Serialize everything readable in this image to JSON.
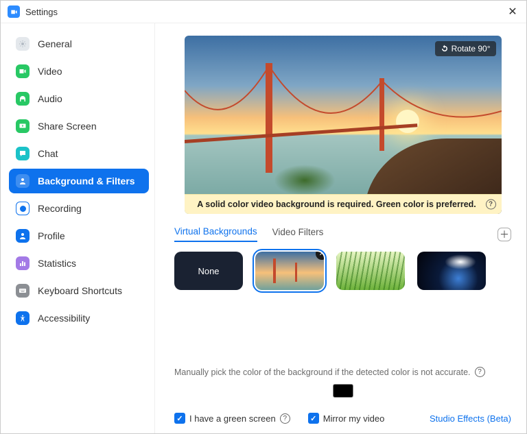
{
  "window": {
    "title": "Settings"
  },
  "sidebar": {
    "items": [
      {
        "label": "General"
      },
      {
        "label": "Video"
      },
      {
        "label": "Audio"
      },
      {
        "label": "Share Screen"
      },
      {
        "label": "Chat"
      },
      {
        "label": "Background & Filters"
      },
      {
        "label": "Recording"
      },
      {
        "label": "Profile"
      },
      {
        "label": "Statistics"
      },
      {
        "label": "Keyboard Shortcuts"
      },
      {
        "label": "Accessibility"
      }
    ],
    "active_index": 5
  },
  "preview": {
    "rotate_label": "Rotate 90°",
    "notice": "A solid color video background is required. Green color is preferred."
  },
  "tabs": {
    "virtual_backgrounds": "Virtual Backgrounds",
    "video_filters": "Video Filters"
  },
  "thumbs": {
    "none_label": "None"
  },
  "hints": {
    "manual_pick": "Manually pick the color of the background if the detected color is not accurate."
  },
  "color_swatch": "#000000",
  "options": {
    "green_screen": "I have a green screen",
    "mirror": "Mirror my video",
    "studio_effects": "Studio Effects (Beta)"
  }
}
